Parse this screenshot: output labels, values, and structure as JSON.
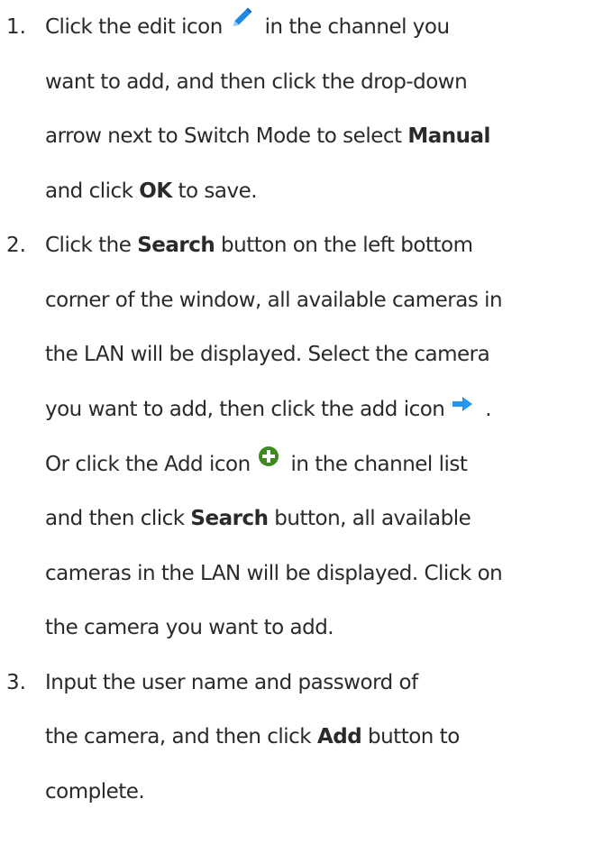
{
  "steps": [
    {
      "number": "1.",
      "lines": [
        {
          "before": "Click the edit icon",
          "icon": "pencil-icon",
          "after": " in the channel you"
        },
        {
          "text": "want to add, and then click the drop-down"
        },
        {
          "before": "arrow next to Switch Mode to select ",
          "bold": "Manual",
          "after": ""
        },
        {
          "before": "and click ",
          "bold": "OK",
          "after": " to save."
        }
      ]
    },
    {
      "number": "2.",
      "lines": [
        {
          "before": "Click the ",
          "bold": "Search",
          "after": " button on the left bottom"
        },
        {
          "text": "corner of the window, all available cameras in"
        },
        {
          "text": "the LAN will be displayed. Select the camera"
        },
        {
          "before": "you want to add, then click the add icon",
          "icon": "arrow-right-icon",
          "after": " ."
        },
        {
          "before": "Or click the Add icon",
          "icon": "add-circle-icon",
          "after": " in the channel list"
        },
        {
          "before": "and then click ",
          "bold": "Search",
          "after": " button, all available"
        },
        {
          "text": "cameras in the LAN will be displayed. Click on"
        },
        {
          "text": "the camera you want to add."
        }
      ]
    },
    {
      "number": "3.",
      "lines": [
        {
          "text": "Input the user name and password of"
        },
        {
          "before": "the camera, and then click ",
          "bold": "Add",
          "after": " button to"
        },
        {
          "text": "complete."
        }
      ]
    }
  ],
  "colors": {
    "text": "#2a2a2a",
    "pencil": "#1e88e5",
    "arrow": "#2196f3",
    "add": "#3a8a1e"
  }
}
